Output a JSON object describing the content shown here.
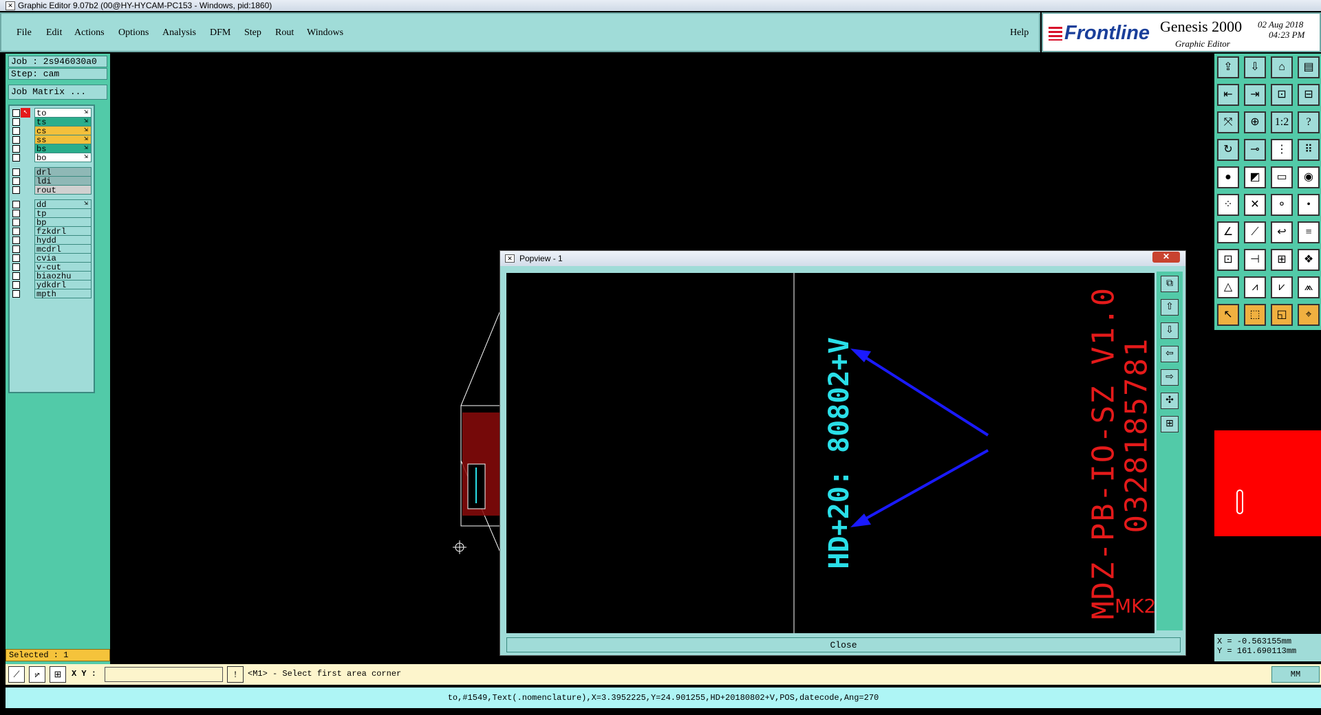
{
  "window": {
    "title": "Graphic Editor 9.07b2 (00@HY-HYCAM-PC153 - Windows, pid:1860)"
  },
  "menu": {
    "items": [
      "File",
      "Edit",
      "Actions",
      "Options",
      "Analysis",
      "DFM",
      "Step",
      "Rout",
      "Windows"
    ],
    "help": "Help"
  },
  "brand": {
    "logo": "Frontline",
    "product": "Genesis 2000",
    "subtitle": "Graphic Editor",
    "date": "02  Aug  2018",
    "time": "04:23  PM"
  },
  "job": {
    "job_label": "Job : 2s946030a0",
    "step_label": "Step: cam",
    "matrix_button": "Job Matrix ..."
  },
  "layers": [
    {
      "name": "to",
      "color": "#ffffff",
      "affected": "⇲"
    },
    {
      "name": "ts",
      "color": "#2bae8c",
      "affected": "⇲"
    },
    {
      "name": "cs",
      "color": "#f4c03c",
      "affected": "⇲"
    },
    {
      "name": "ss",
      "color": "#f4c03c",
      "affected": "⇲"
    },
    {
      "name": "bs",
      "color": "#2bae8c",
      "affected": "⇲"
    },
    {
      "name": "bo",
      "color": "#ffffff",
      "affected": "⇲"
    },
    {
      "name": "drl",
      "color": "#8fb8b6",
      "affected": ""
    },
    {
      "name": "ldi",
      "color": "#8fb8b6",
      "affected": ""
    },
    {
      "name": "rout",
      "color": "#d0d0d0",
      "affected": ""
    },
    {
      "name": "dd",
      "color": "#a0dcd8",
      "affected": "⇲"
    },
    {
      "name": "tp",
      "color": "#a0dcd8",
      "affected": ""
    },
    {
      "name": "bp",
      "color": "#a0dcd8",
      "affected": ""
    },
    {
      "name": "fzkdrl",
      "color": "#a0dcd8",
      "affected": ""
    },
    {
      "name": "hydd",
      "color": "#a0dcd8",
      "affected": ""
    },
    {
      "name": "mcdrl",
      "color": "#a0dcd8",
      "affected": ""
    },
    {
      "name": "cvia",
      "color": "#a0dcd8",
      "affected": ""
    },
    {
      "name": "v-cut",
      "color": "#a0dcd8",
      "affected": ""
    },
    {
      "name": "biaozhu",
      "color": "#a0dcd8",
      "affected": ""
    },
    {
      "name": "ydkdrl",
      "color": "#a0dcd8",
      "affected": ""
    },
    {
      "name": "mpth",
      "color": "#a0dcd8",
      "affected": ""
    }
  ],
  "selected": "Selected : 1",
  "popview": {
    "title": "Popview - 1",
    "close_label": "Close",
    "text_cyan": "HD+20: 80802+V",
    "text_red_1": "MDZ-PB-IO-SZ V1.0",
    "text_red_2": "0328185781",
    "text_red_3": "MK2"
  },
  "coords": {
    "x": "X = -0.563155mm",
    "y": "Y = 161.690113mm"
  },
  "bottom": {
    "xy_label": "X Y :",
    "xy_value": "",
    "prompt": "<M1> - Select first area corner",
    "units": "MM"
  },
  "status": "to,#1549,Text(.nomenclature),X=3.3952225,Y=24.901255,HD+20180802+V,POS,datecode,Ang=270"
}
